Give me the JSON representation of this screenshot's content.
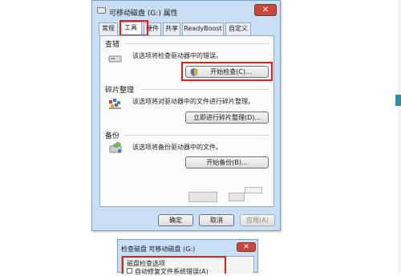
{
  "properties_window": {
    "title": "可移动磁盘 (G:) 属性",
    "close_symbol": "✕",
    "tabs": [
      {
        "label": "常规"
      },
      {
        "label": "工具"
      },
      {
        "label": "硬件"
      },
      {
        "label": "共享"
      },
      {
        "label": "ReadyBoost"
      },
      {
        "label": "自定义"
      }
    ],
    "active_tab": "工具",
    "groups": {
      "check": {
        "label": "查错",
        "description": "该选项将检查驱动器中的错误。",
        "button": "开始检查(C)..."
      },
      "defrag": {
        "label": "碎片整理",
        "description": "该选项将对驱动器中的文件进行碎片整理。",
        "button": "立即进行碎片整理(D)..."
      },
      "backup": {
        "label": "备份",
        "description": "该选项将备份驱动器中的文件。",
        "button": "开始备份(B)..."
      }
    },
    "footer": {
      "ok": "确定",
      "cancel": "取消",
      "apply": "应用(A)"
    },
    "highlight_color": "#e0201a"
  },
  "check_disk_window": {
    "title": "检查磁盘 可移动磁盘 (G:)",
    "close_symbol": "✕",
    "group_label": "磁盘检查选项",
    "option": "自动修复文件系统错误(A)"
  }
}
